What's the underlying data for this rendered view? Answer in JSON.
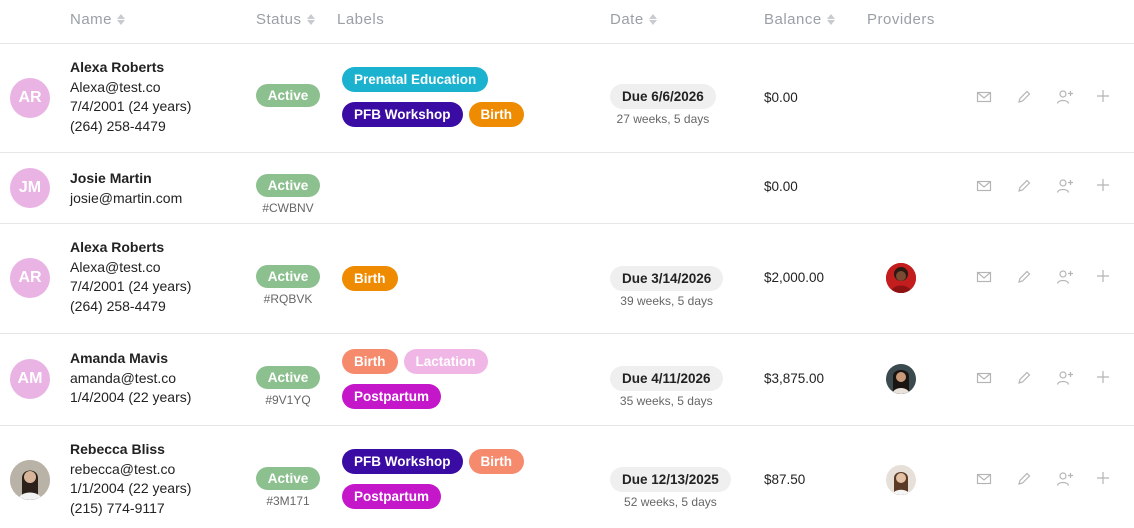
{
  "header": {
    "name": "Name",
    "status": "Status",
    "labels": "Labels",
    "date": "Date",
    "balance": "Balance",
    "providers": "Providers"
  },
  "label_colors": {
    "Prenatal Education": "#1ab2cf",
    "PFB Workshop": "#3a0ca3",
    "Birth": "#ef8b00",
    "Birth (light)": "#f58a6d",
    "Lactation": "#f0b6e6",
    "Postpartum": "#c417c9"
  },
  "rows": [
    {
      "initials": "AR",
      "name": "Alexa Roberts",
      "email": "Alexa@test.co",
      "dob": "7/4/2001 (24 years)",
      "phone": "(264) 258-4479",
      "status": "Active",
      "code": "",
      "labels": [
        "Prenatal Education",
        "PFB Workshop",
        "Birth"
      ],
      "due": "Due 6/6/2026",
      "weeks": "27 weeks, 5 days",
      "balance": "$0.00",
      "has_provider": false
    },
    {
      "initials": "JM",
      "name": "Josie Martin",
      "email": "josie@martin.com",
      "dob": "",
      "phone": "",
      "status": "Active",
      "code": "#CWBNV",
      "labels": [],
      "due": "",
      "weeks": "",
      "balance": "$0.00",
      "has_provider": false
    },
    {
      "initials": "AR",
      "name": "Alexa Roberts",
      "email": "Alexa@test.co",
      "dob": "7/4/2001 (24 years)",
      "phone": "(264) 258-4479",
      "status": "Active",
      "code": "#RQBVK",
      "labels": [
        "Birth"
      ],
      "due": "Due 3/14/2026",
      "weeks": "39 weeks, 5 days",
      "balance": "$2,000.00",
      "has_provider": true
    },
    {
      "initials": "AM",
      "name": "Amanda Mavis",
      "email": "amanda@test.co",
      "dob": "1/4/2004 (22 years)",
      "phone": "",
      "status": "Active",
      "code": "#9V1YQ",
      "labels": [
        "Birth",
        "Lactation",
        "Postpartum"
      ],
      "due": "Due 4/11/2026",
      "weeks": "35 weeks, 5 days",
      "balance": "$3,875.00",
      "has_provider": true
    },
    {
      "initials": "",
      "name": "Rebecca Bliss",
      "email": "rebecca@test.co",
      "dob": "1/1/2004 (22 years)",
      "phone": "(215) 774-9117",
      "status": "Active",
      "code": "#3M171",
      "labels": [
        "PFB Workshop",
        "Birth",
        "Postpartum"
      ],
      "due": "Due 12/13/2025",
      "weeks": "52 weeks, 5 days",
      "balance": "$87.50",
      "has_provider": true
    }
  ],
  "icons": [
    "mail-icon",
    "pencil-icon",
    "add-user-icon",
    "plus-icon"
  ]
}
